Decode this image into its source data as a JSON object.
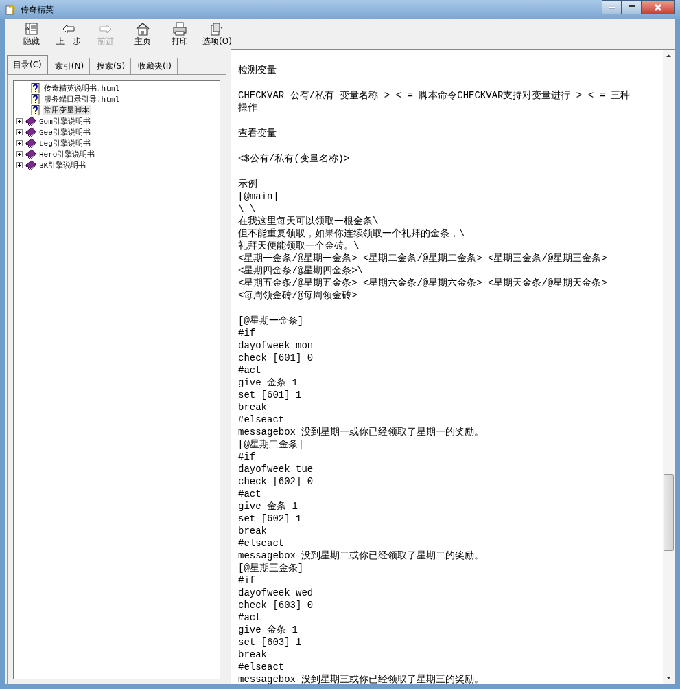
{
  "window": {
    "title": "传奇精英"
  },
  "toolbar": [
    {
      "label": "隐藏",
      "disabled": false
    },
    {
      "label": "上一步",
      "disabled": false
    },
    {
      "label": "前进",
      "disabled": true
    },
    {
      "label": "主页",
      "disabled": false
    },
    {
      "label": "打印",
      "disabled": false
    },
    {
      "label": "选项(O)",
      "disabled": false
    }
  ],
  "tabs": [
    {
      "label": "目录(C)",
      "selected": true
    },
    {
      "label": "索引(N)",
      "selected": false
    },
    {
      "label": "搜索(S)",
      "selected": false
    },
    {
      "label": "收藏夹(I)",
      "selected": false
    }
  ],
  "tree": [
    {
      "kind": "page",
      "label": "传奇精英说明书.html",
      "selected": false
    },
    {
      "kind": "page",
      "label": "服务端目录引导.html",
      "selected": false
    },
    {
      "kind": "page",
      "label": "常用变量脚本",
      "selected": true
    },
    {
      "kind": "book",
      "label": "Gom引擎说明书",
      "expanded": false,
      "selected": false
    },
    {
      "kind": "book",
      "label": "Gee引擎说明书",
      "expanded": false,
      "selected": false
    },
    {
      "kind": "book",
      "label": "Leg引擎说明书",
      "expanded": false,
      "selected": false
    },
    {
      "kind": "book",
      "label": "Hero引擎说明书",
      "expanded": false,
      "selected": false
    },
    {
      "kind": "book",
      "label": "3K引擎说明书",
      "expanded": false,
      "selected": false
    }
  ],
  "content": [
    [
      "检测变量"
    ],
    [
      "CHECKVAR 公有/私有 变量名称 > < = 脚本命令CHECKVAR支持对变量进行 > < = 三种操作"
    ],
    [
      "查看变量"
    ],
    [
      "<$公有/私有(变量名称)>"
    ],
    [
      "示例",
      "[@main]",
      "\\ \\",
      "在我这里每天可以领取一根金条\\",
      "但不能重复领取，如果你连续领取一个礼拜的金条，\\",
      "礼拜天便能领取一个金砖。\\",
      "<星期一金条/@星期一金条> <星期二金条/@星期二金条> <星期三金条/@星期三金条>",
      "<星期四金条/@星期四金条>\\",
      "<星期五金条/@星期五金条> <星期六金条/@星期六金条> <星期天金条/@星期天金条>",
      "<每周领金砖/@每周领金砖>"
    ],
    [
      "[@星期一金条]",
      "#if",
      "dayofweek mon",
      "check [601] 0",
      "#act",
      "give 金条 1",
      "set [601] 1",
      "break",
      "#elseact",
      "messagebox 没到星期一或你已经领取了星期一的奖励。",
      "[@星期二金条]",
      "#if",
      "dayofweek tue",
      "check [602] 0",
      "#act",
      "give 金条 1",
      "set [602] 1",
      "break",
      "#elseact",
      "messagebox 没到星期二或你已经领取了星期二的奖励。",
      "[@星期三金条]",
      "#if",
      "dayofweek wed",
      "check [603] 0",
      "#act",
      "give 金条 1",
      "set [603] 1",
      "break",
      "#elseact",
      "messagebox 没到星期三或你已经领取了星期三的奖励。"
    ]
  ]
}
